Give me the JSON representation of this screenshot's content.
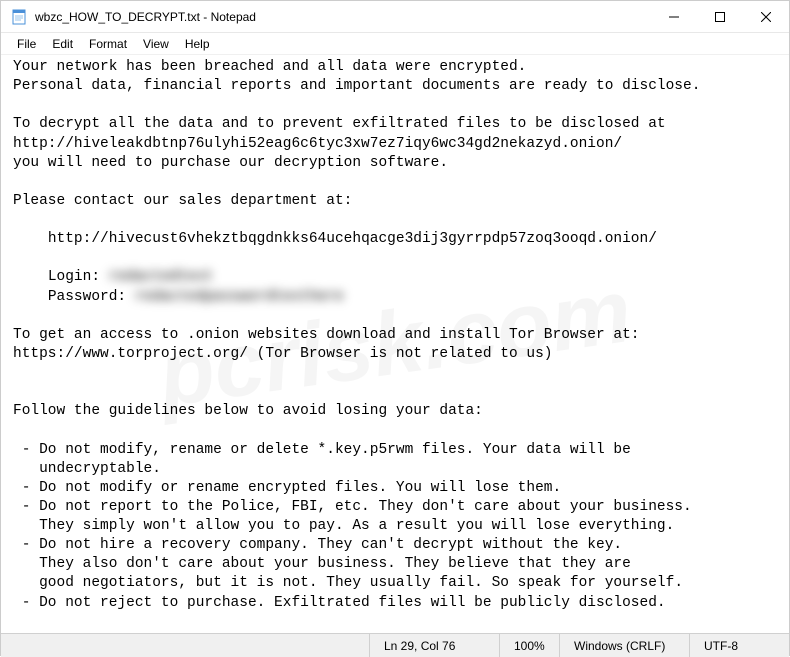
{
  "titlebar": {
    "title": "wbzc_HOW_TO_DECRYPT.txt - Notepad"
  },
  "menu": {
    "file": "File",
    "edit": "Edit",
    "format": "Format",
    "view": "View",
    "help": "Help"
  },
  "content": {
    "line1": "Your network has been breached and all data were encrypted.",
    "line2": "Personal data, financial reports and important documents are ready to disclose.",
    "line3": "",
    "line4": "To decrypt all the data and to prevent exfiltrated files to be disclosed at",
    "line5": "http://hiveleakdbtnp76ulyhi52eag6c6tyc3xw7ez7iqy6wc34gd2nekazyd.onion/",
    "line6": "you will need to purchase our decryption software.",
    "line7": "",
    "line8": "Please contact our sales department at:",
    "line9": "",
    "line10": "    http://hivecust6vhekztbqgdnkks64ucehqacge3dij3gyrrpdp57zoq3ooqd.onion/",
    "line11": "",
    "line12_label": "    Login: ",
    "line12_value": "redactedtext",
    "line13_label": "    Password: ",
    "line13_value": "redactedpasswordtexthere",
    "line14": "",
    "line15": "To get an access to .onion websites download and install Tor Browser at:",
    "line16": "https://www.torproject.org/ (Tor Browser is not related to us)",
    "line17": "",
    "line18": "",
    "line19": "Follow the guidelines below to avoid losing your data:",
    "line20": "",
    "line21": " - Do not modify, rename or delete *.key.p5rwm files. Your data will be",
    "line22": "   undecryptable.",
    "line23": " - Do not modify or rename encrypted files. You will lose them.",
    "line24": " - Do not report to the Police, FBI, etc. They don't care about your business.",
    "line25": "   They simply won't allow you to pay. As a result you will lose everything.",
    "line26": " - Do not hire a recovery company. They can't decrypt without the key.",
    "line27": "   They also don't care about your business. They believe that they are",
    "line28": "   good negotiators, but it is not. They usually fail. So speak for yourself.",
    "line29": " - Do not reject to purchase. Exfiltrated files will be publicly disclosed."
  },
  "statusbar": {
    "position": "Ln 29, Col 76",
    "zoom": "100%",
    "lineending": "Windows (CRLF)",
    "encoding": "UTF-8"
  },
  "watermark": "pcrisk.com"
}
